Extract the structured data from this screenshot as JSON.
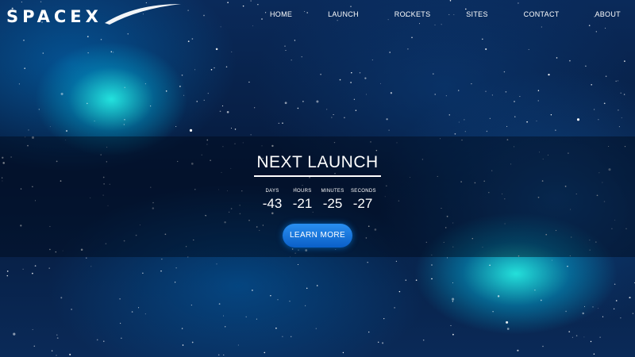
{
  "logo": {
    "text": "SPACEX"
  },
  "nav": {
    "items": [
      {
        "label": "HOME"
      },
      {
        "label": "LAUNCH"
      },
      {
        "label": "ROCKETS"
      },
      {
        "label": "SITES"
      },
      {
        "label": "CONTACT"
      },
      {
        "label": "ABOUT"
      }
    ]
  },
  "hero": {
    "title": "NEXT LAUNCH",
    "countdown": [
      {
        "label": "DAYS",
        "value": "-43"
      },
      {
        "label": "HOURS",
        "value": "-21"
      },
      {
        "label": "MINUTES",
        "value": "-25"
      },
      {
        "label": "SECONDS",
        "value": "-27"
      }
    ],
    "cta_label": "LEARN MORE"
  },
  "colors": {
    "accent": "#1a7fe8",
    "background": "#06142b",
    "nebula": "#28fff0"
  }
}
